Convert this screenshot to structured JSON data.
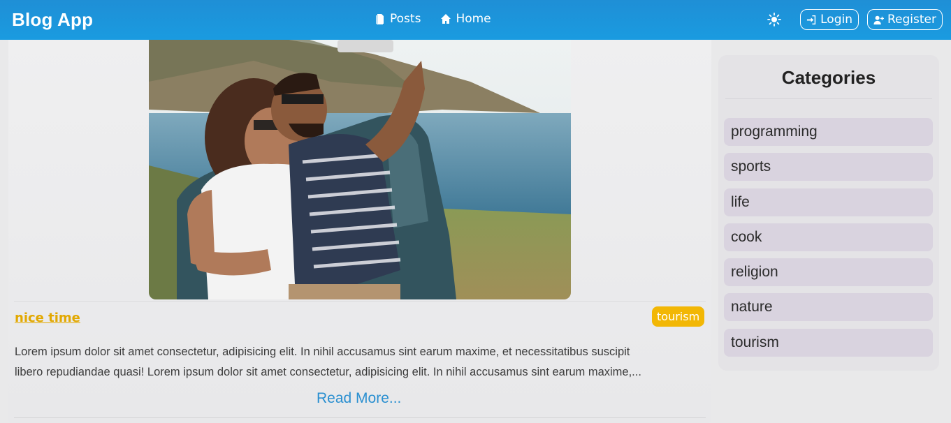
{
  "navbar": {
    "brand": "Blog App",
    "links": [
      {
        "label": "Posts",
        "icon": "posts-icon"
      },
      {
        "label": "Home",
        "icon": "home-icon"
      }
    ],
    "theme_icon": "sun-icon",
    "login_label": "Login",
    "register_label": "Register",
    "color": "#1a9be0"
  },
  "post": {
    "title": "nice time",
    "category": "tourism",
    "excerpt_line1": "Lorem ipsum dolor sit amet consectetur, adipisicing elit. In nihil accusamus sint earum maxime, et necessitatibus suscipit",
    "excerpt_line2": "libero repudiandae quasi! Lorem ipsum dolor sit amet consectetur, adipisicing elit. In nihil accusamus sint earum maxime,...",
    "read_more": "Read More...",
    "title_color": "#e2a800",
    "category_color": "#f2b705"
  },
  "sidebar": {
    "title": "Categories",
    "items": [
      {
        "label": "programming"
      },
      {
        "label": "sports"
      },
      {
        "label": "life"
      },
      {
        "label": "cook"
      },
      {
        "label": "religion"
      },
      {
        "label": "nature"
      },
      {
        "label": "tourism"
      }
    ]
  }
}
